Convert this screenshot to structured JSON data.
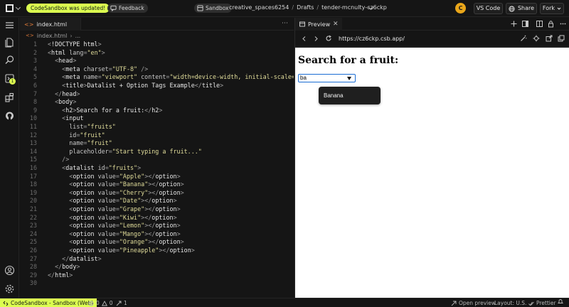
{
  "topbar": {
    "update_badge": "CodeSandbox was updated!",
    "feedback_label": "Feedback",
    "sandbox_label": "Sandbox",
    "workspace": "creative_spaces6254",
    "folder": "Drafts",
    "project": "tender-mcnulty-cz6ckp",
    "avatar_initial": "C",
    "vscode_label": "VS Code",
    "share_label": "Share",
    "fork_label": "Fork"
  },
  "activity_bar": {
    "icons": [
      "menu-icon",
      "files-icon",
      "search-icon",
      "source-control-icon",
      "extensions-icon",
      "github-icon",
      "account-icon",
      "settings-icon"
    ],
    "badge_count": "1"
  },
  "editor": {
    "tab_label": "index.html",
    "breadcrumb_file": "index.html",
    "breadcrumb_more": "...",
    "lines": [
      {
        "n": "1",
        "parts": [
          [
            "punc",
            "<"
          ],
          [
            "tag",
            "!DOCTYPE"
          ],
          [
            "txt",
            " html"
          ],
          [
            "punc",
            ">"
          ]
        ]
      },
      {
        "n": "2",
        "parts": [
          [
            "punc",
            "<"
          ],
          [
            "tag",
            "html"
          ],
          [
            "attr",
            " lang"
          ],
          [
            "punc",
            "="
          ],
          [
            "str",
            "\"en\""
          ],
          [
            "punc",
            ">"
          ]
        ]
      },
      {
        "n": "3",
        "parts": [
          [
            "txt",
            "  "
          ],
          [
            "punc",
            "<"
          ],
          [
            "tag",
            "head"
          ],
          [
            "punc",
            ">"
          ]
        ]
      },
      {
        "n": "4",
        "parts": [
          [
            "txt",
            "    "
          ],
          [
            "punc",
            "<"
          ],
          [
            "tag",
            "meta"
          ],
          [
            "attr",
            " charset"
          ],
          [
            "punc",
            "="
          ],
          [
            "str",
            "\"UTF-8\""
          ],
          [
            "punc",
            " />"
          ]
        ]
      },
      {
        "n": "5",
        "parts": [
          [
            "txt",
            "    "
          ],
          [
            "punc",
            "<"
          ],
          [
            "tag",
            "meta"
          ],
          [
            "attr",
            " name"
          ],
          [
            "punc",
            "="
          ],
          [
            "str",
            "\"viewport\""
          ],
          [
            "attr",
            " content"
          ],
          [
            "punc",
            "="
          ],
          [
            "str",
            "\"width=device-width, initial-scale=1.0\""
          ]
        ]
      },
      {
        "n": "6",
        "parts": [
          [
            "txt",
            "    "
          ],
          [
            "punc",
            "<"
          ],
          [
            "tag",
            "title"
          ],
          [
            "punc",
            ">"
          ],
          [
            "txt",
            "Datalist + Option Tags Example"
          ],
          [
            "punc",
            "</"
          ],
          [
            "tag",
            "title"
          ],
          [
            "punc",
            ">"
          ]
        ]
      },
      {
        "n": "7",
        "parts": [
          [
            "txt",
            "  "
          ],
          [
            "punc",
            "</"
          ],
          [
            "tag",
            "head"
          ],
          [
            "punc",
            ">"
          ]
        ]
      },
      {
        "n": "8",
        "parts": [
          [
            "txt",
            "  "
          ],
          [
            "punc",
            "<"
          ],
          [
            "tag",
            "body"
          ],
          [
            "punc",
            ">"
          ]
        ]
      },
      {
        "n": "9",
        "parts": [
          [
            "txt",
            "    "
          ],
          [
            "punc",
            "<"
          ],
          [
            "tag",
            "h2"
          ],
          [
            "punc",
            ">"
          ],
          [
            "txt",
            "Search for a fruit:"
          ],
          [
            "punc",
            "</"
          ],
          [
            "tag",
            "h2"
          ],
          [
            "punc",
            ">"
          ]
        ]
      },
      {
        "n": "10",
        "parts": [
          [
            "txt",
            "    "
          ],
          [
            "punc",
            "<"
          ],
          [
            "tag",
            "input"
          ]
        ]
      },
      {
        "n": "11",
        "parts": [
          [
            "attr",
            "      list"
          ],
          [
            "punc",
            "="
          ],
          [
            "str",
            "\"fruits\""
          ]
        ]
      },
      {
        "n": "12",
        "parts": [
          [
            "attr",
            "      id"
          ],
          [
            "punc",
            "="
          ],
          [
            "str",
            "\"fruit\""
          ]
        ]
      },
      {
        "n": "13",
        "parts": [
          [
            "attr",
            "      name"
          ],
          [
            "punc",
            "="
          ],
          [
            "str",
            "\"fruit\""
          ]
        ]
      },
      {
        "n": "14",
        "parts": [
          [
            "attr",
            "      placeholder"
          ],
          [
            "punc",
            "="
          ],
          [
            "str",
            "\"Start typing a fruit...\""
          ]
        ]
      },
      {
        "n": "15",
        "parts": [
          [
            "punc",
            "    />"
          ]
        ]
      },
      {
        "n": "16",
        "parts": [
          [
            "txt",
            "    "
          ],
          [
            "punc",
            "<"
          ],
          [
            "tag",
            "datalist"
          ],
          [
            "attr",
            " id"
          ],
          [
            "punc",
            "="
          ],
          [
            "str",
            "\"fruits\""
          ],
          [
            "punc",
            ">"
          ]
        ]
      },
      {
        "n": "17",
        "parts": [
          [
            "txt",
            "      "
          ],
          [
            "punc",
            "<"
          ],
          [
            "tag",
            "option"
          ],
          [
            "attr",
            " value"
          ],
          [
            "punc",
            "="
          ],
          [
            "str",
            "\"Apple\""
          ],
          [
            "punc",
            "></"
          ],
          [
            "tag",
            "option"
          ],
          [
            "punc",
            ">"
          ]
        ]
      },
      {
        "n": "18",
        "parts": [
          [
            "txt",
            "      "
          ],
          [
            "punc",
            "<"
          ],
          [
            "tag",
            "option"
          ],
          [
            "attr",
            " value"
          ],
          [
            "punc",
            "="
          ],
          [
            "str",
            "\"Banana\""
          ],
          [
            "punc",
            "></"
          ],
          [
            "tag",
            "option"
          ],
          [
            "punc",
            ">"
          ]
        ]
      },
      {
        "n": "19",
        "parts": [
          [
            "txt",
            "      "
          ],
          [
            "punc",
            "<"
          ],
          [
            "tag",
            "option"
          ],
          [
            "attr",
            " value"
          ],
          [
            "punc",
            "="
          ],
          [
            "str",
            "\"Cherry\""
          ],
          [
            "punc",
            "></"
          ],
          [
            "tag",
            "option"
          ],
          [
            "punc",
            ">"
          ]
        ]
      },
      {
        "n": "20",
        "parts": [
          [
            "txt",
            "      "
          ],
          [
            "punc",
            "<"
          ],
          [
            "tag",
            "option"
          ],
          [
            "attr",
            " value"
          ],
          [
            "punc",
            "="
          ],
          [
            "str",
            "\"Date\""
          ],
          [
            "punc",
            "></"
          ],
          [
            "tag",
            "option"
          ],
          [
            "punc",
            ">"
          ]
        ]
      },
      {
        "n": "21",
        "parts": [
          [
            "txt",
            "      "
          ],
          [
            "punc",
            "<"
          ],
          [
            "tag",
            "option"
          ],
          [
            "attr",
            " value"
          ],
          [
            "punc",
            "="
          ],
          [
            "str",
            "\"Grape\""
          ],
          [
            "punc",
            "></"
          ],
          [
            "tag",
            "option"
          ],
          [
            "punc",
            ">"
          ]
        ]
      },
      {
        "n": "22",
        "parts": [
          [
            "txt",
            "      "
          ],
          [
            "punc",
            "<"
          ],
          [
            "tag",
            "option"
          ],
          [
            "attr",
            " value"
          ],
          [
            "punc",
            "="
          ],
          [
            "str",
            "\"Kiwi\""
          ],
          [
            "punc",
            "></"
          ],
          [
            "tag",
            "option"
          ],
          [
            "punc",
            ">"
          ]
        ]
      },
      {
        "n": "23",
        "parts": [
          [
            "txt",
            "      "
          ],
          [
            "punc",
            "<"
          ],
          [
            "tag",
            "option"
          ],
          [
            "attr",
            " value"
          ],
          [
            "punc",
            "="
          ],
          [
            "str",
            "\"Lemon\""
          ],
          [
            "punc",
            "></"
          ],
          [
            "tag",
            "option"
          ],
          [
            "punc",
            ">"
          ]
        ]
      },
      {
        "n": "24",
        "parts": [
          [
            "txt",
            "      "
          ],
          [
            "punc",
            "<"
          ],
          [
            "tag",
            "option"
          ],
          [
            "attr",
            " value"
          ],
          [
            "punc",
            "="
          ],
          [
            "str",
            "\"Mango\""
          ],
          [
            "punc",
            "></"
          ],
          [
            "tag",
            "option"
          ],
          [
            "punc",
            ">"
          ]
        ]
      },
      {
        "n": "25",
        "parts": [
          [
            "txt",
            "      "
          ],
          [
            "punc",
            "<"
          ],
          [
            "tag",
            "option"
          ],
          [
            "attr",
            " value"
          ],
          [
            "punc",
            "="
          ],
          [
            "str",
            "\"Orange\""
          ],
          [
            "punc",
            "></"
          ],
          [
            "tag",
            "option"
          ],
          [
            "punc",
            ">"
          ]
        ]
      },
      {
        "n": "26",
        "parts": [
          [
            "txt",
            "      "
          ],
          [
            "punc",
            "<"
          ],
          [
            "tag",
            "option"
          ],
          [
            "attr",
            " value"
          ],
          [
            "punc",
            "="
          ],
          [
            "str",
            "\"Pineapple\""
          ],
          [
            "punc",
            "></"
          ],
          [
            "tag",
            "option"
          ],
          [
            "punc",
            ">"
          ]
        ]
      },
      {
        "n": "27",
        "parts": [
          [
            "txt",
            "    "
          ],
          [
            "punc",
            "</"
          ],
          [
            "tag",
            "datalist"
          ],
          [
            "punc",
            ">"
          ]
        ]
      },
      {
        "n": "28",
        "parts": [
          [
            "txt",
            "  "
          ],
          [
            "punc",
            "</"
          ],
          [
            "tag",
            "body"
          ],
          [
            "punc",
            ">"
          ]
        ]
      },
      {
        "n": "29",
        "parts": [
          [
            "punc",
            "</"
          ],
          [
            "tag",
            "html"
          ],
          [
            "punc",
            ">"
          ]
        ]
      },
      {
        "n": "30",
        "parts": []
      }
    ]
  },
  "preview": {
    "tab_label": "Preview",
    "url": "https://cz6ckp.csb.app/",
    "page": {
      "heading": "Search for a fruit:",
      "input_value": "ba",
      "suggestion": "Banana"
    }
  },
  "statusbar": {
    "remote_label": "CodeSandbox - Sandbox (Web)",
    "errors": "0",
    "warnings": "0",
    "ports": "1",
    "open_preview": "Open preview",
    "layout": "Layout: U.S.",
    "prettier": "Prettier"
  },
  "colors": {
    "accent_lime": "#dcff50",
    "avatar_orange": "#e9a61a",
    "string_yellow": "#e0dc9a",
    "input_focus_blue": "#1a6cd3"
  }
}
